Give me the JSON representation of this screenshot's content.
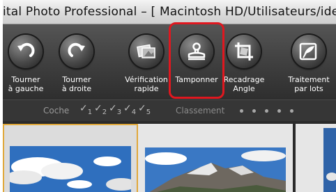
{
  "window": {
    "title": "ital Photo Professional – [ Macintosh HD/Utilisateurs/idea/I"
  },
  "toolbar": {
    "highlight_color": "#e0171f",
    "buttons": [
      {
        "label": "Tourner\nà gauche",
        "icon": "rotate-left-icon"
      },
      {
        "label": "Tourner\nà droite",
        "icon": "rotate-right-icon"
      },
      {
        "label": "Vérification\nrapide",
        "icon": "quick-check-icon"
      },
      {
        "label": "Tamponner",
        "icon": "stamp-icon"
      },
      {
        "label": "Recadrage\nAngle",
        "icon": "crop-angle-icon"
      },
      {
        "label": "Traitement\npar lots",
        "icon": "batch-process-icon"
      }
    ]
  },
  "ratingbar": {
    "check_label": "Coche",
    "check_numbers": [
      "1",
      "2",
      "3",
      "4",
      "5"
    ],
    "sort_label": "Classement"
  },
  "thumbnails": {
    "selected_border_color": "#e0a83a"
  }
}
